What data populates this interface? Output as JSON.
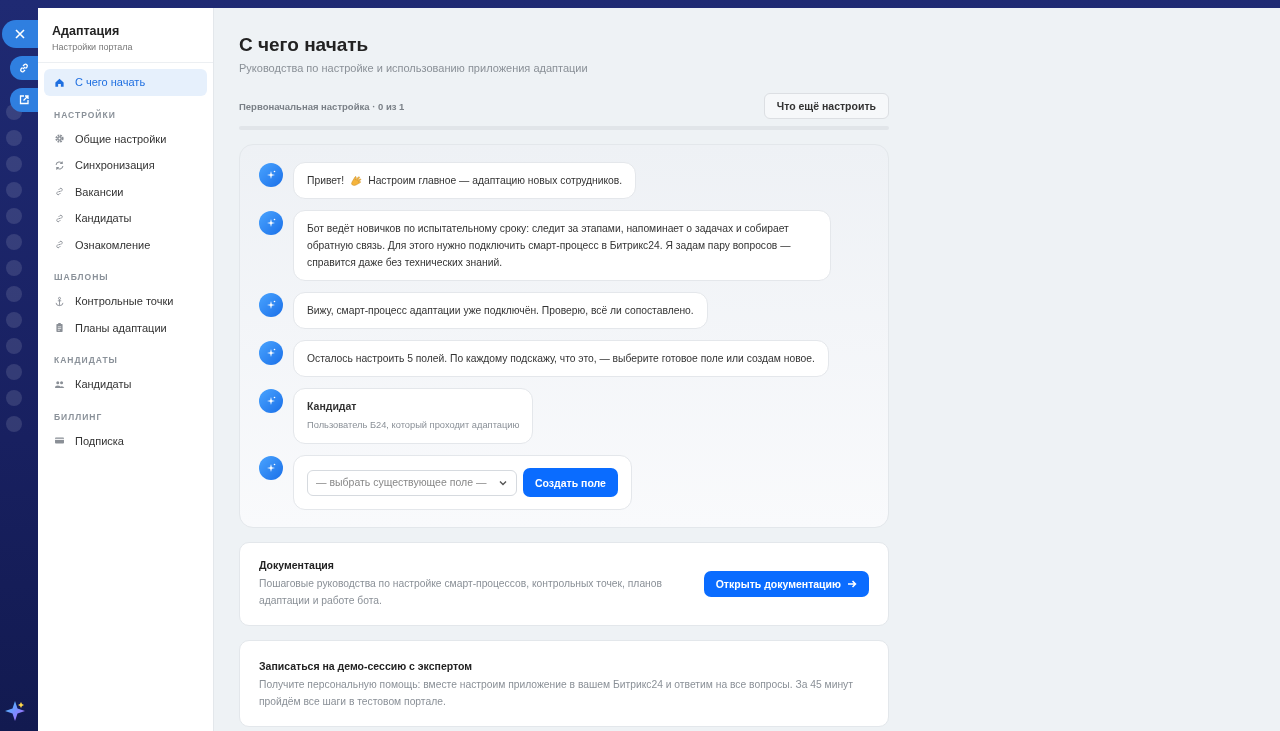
{
  "sidebar": {
    "title": "Адаптация",
    "subtitle": "Настройки портала",
    "sections": [
      {
        "items": [
          {
            "label": "С чего начать",
            "kind": "home",
            "selected": true
          }
        ]
      },
      {
        "heading": "НАСТРОЙКИ",
        "items": [
          {
            "label": "Общие настройки",
            "kind": "gear",
            "selected": false
          },
          {
            "label": "Синхронизация",
            "kind": "sync",
            "selected": false
          },
          {
            "label": "Вакансии",
            "kind": "link",
            "selected": false
          },
          {
            "label": "Кандидаты",
            "kind": "link",
            "selected": false
          },
          {
            "label": "Ознакомление",
            "kind": "link",
            "selected": false
          }
        ]
      },
      {
        "heading": "ШАБЛОНЫ",
        "items": [
          {
            "label": "Контрольные точки",
            "kind": "anchor",
            "selected": false
          },
          {
            "label": "Планы адаптации",
            "kind": "clipboard",
            "selected": false
          }
        ]
      },
      {
        "heading": "КАНДИДАТЫ",
        "items": [
          {
            "label": "Кандидаты",
            "kind": "people",
            "selected": false
          }
        ]
      },
      {
        "heading": "БИЛЛИНГ",
        "items": [
          {
            "label": "Подписка",
            "kind": "card",
            "selected": false
          }
        ]
      }
    ]
  },
  "page": {
    "title": "С чего начать",
    "subtitle": "Руководства по настройке и использованию приложения адаптации"
  },
  "progress": {
    "label": "Первоначальная настройка · 0 из 1",
    "level": 0,
    "button": "Что ещё настроить"
  },
  "chat": [
    {
      "kind": "greeting",
      "text": "Привет!",
      "text_after": "Настроим главное — адаптацию новых сотрудников."
    },
    {
      "kind": "text",
      "text": "Бот ведёт новичков по испытательному сроку: следит за этапами, напоминает о задачах и собирает обратную связь. Для этого нужно подключить смарт-процесс в Битрикс24. Я задам пару вопросов — справится даже без технических знаний."
    },
    {
      "kind": "text",
      "text": "Вижу, смарт-процесс адаптации уже подключён. Проверю, всё ли сопоставлено."
    },
    {
      "kind": "text",
      "text": "Осталось настроить 5 полей. По каждому подскажу, что это, — выберите готовое поле или создам новое."
    },
    {
      "kind": "field",
      "title": "Кандидат",
      "text": "Пользователь Б24, который проходит адаптацию"
    },
    {
      "kind": "picker",
      "placeholder": "— выбрать существующее поле —",
      "button": "Создать поле"
    }
  ],
  "cards": [
    {
      "title": "Документация",
      "text": "Пошаговые руководства по настройке смарт-процессов, контрольных точек, планов адаптации и работе бота.",
      "button": "Открыть документацию"
    },
    {
      "title": "Записаться на демо-сессию с экспертом",
      "text": "Получите персональную помощь: вместе настроим приложение в вашем Битрикс24 и ответим на все вопросы. За 45 минут пройдём все шаги в тестовом портале."
    }
  ]
}
